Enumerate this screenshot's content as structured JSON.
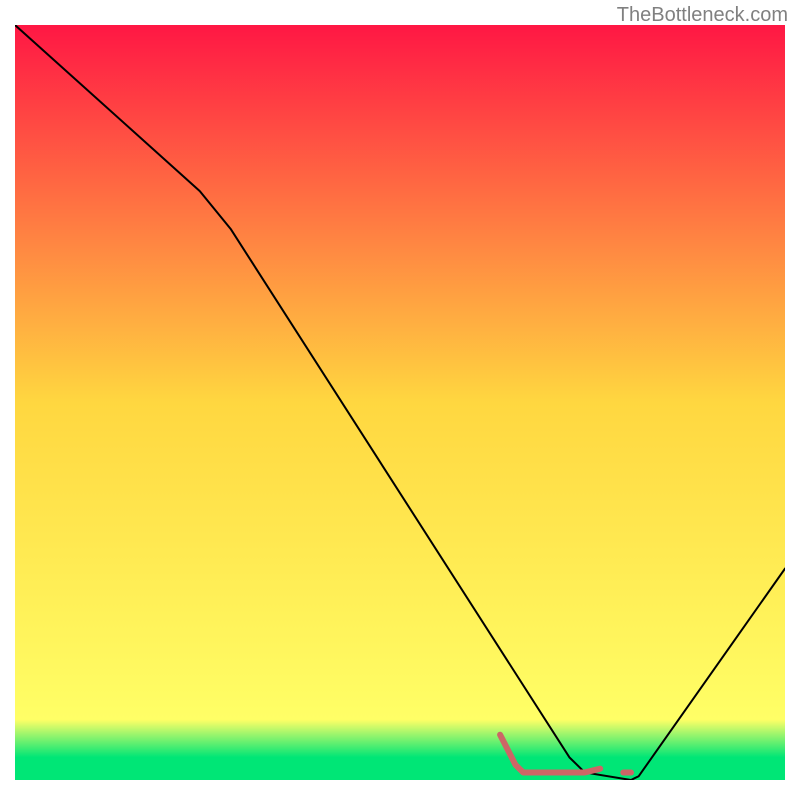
{
  "watermark": "TheBottleneck.com",
  "chart_data": {
    "type": "line",
    "title": "",
    "xlabel": "",
    "ylabel": "",
    "xlim": [
      0,
      100
    ],
    "ylim": [
      0,
      100
    ],
    "gradient_stops": [
      {
        "offset": 0,
        "color": "#ff1744"
      },
      {
        "offset": 50,
        "color": "#ffd740"
      },
      {
        "offset": 92,
        "color": "#ffff66"
      },
      {
        "offset": 97,
        "color": "#00e676"
      },
      {
        "offset": 100,
        "color": "#00e676"
      }
    ],
    "series": [
      {
        "name": "bottleneck-curve",
        "color": "#000000",
        "width": 2,
        "points": [
          {
            "x": 0,
            "y": 100
          },
          {
            "x": 24,
            "y": 78
          },
          {
            "x": 28,
            "y": 73
          },
          {
            "x": 72,
            "y": 3
          },
          {
            "x": 74,
            "y": 1
          },
          {
            "x": 80,
            "y": 0
          },
          {
            "x": 81,
            "y": 0.5
          },
          {
            "x": 100,
            "y": 28
          }
        ]
      },
      {
        "name": "marker-region",
        "color": "#cc6666",
        "width": 6,
        "points": [
          {
            "x": 63,
            "y": 6
          },
          {
            "x": 65,
            "y": 2
          },
          {
            "x": 66,
            "y": 1
          },
          {
            "x": 74,
            "y": 1
          },
          {
            "x": 76,
            "y": 1.5
          }
        ]
      },
      {
        "name": "marker-dot",
        "color": "#cc6666",
        "width": 6,
        "points": [
          {
            "x": 79,
            "y": 1
          },
          {
            "x": 80,
            "y": 1
          }
        ]
      }
    ]
  }
}
